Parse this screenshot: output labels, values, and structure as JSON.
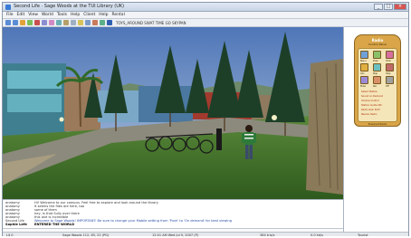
{
  "window": {
    "title": "Second Life · Sage Woods at the TUI Library (UK)"
  },
  "menubar": {
    "items": [
      "File",
      "Edit",
      "View",
      "World",
      "Tools",
      "Help",
      "Client",
      "Help",
      "Rental"
    ]
  },
  "toolbar": {
    "text": "TOYS_AROUND  SWAT  TIME  GO  SKYPAN"
  },
  "chat": {
    "lines": [
      {
        "who": "anatomy",
        "msg": "Hi! Welcome to our campus. Feel free to explore and look around the library"
      },
      {
        "who": "anatomy",
        "msg": "It seems the files are here, too"
      },
      {
        "who": "anatomy",
        "msg": "some of them"
      },
      {
        "who": "anatomy",
        "msg": "hey, is that Sully over there"
      },
      {
        "who": "anatomy",
        "msg": "this one is incredible"
      },
      {
        "who": "Second Life",
        "msg": "Welcome to Sage Woods! IMPORTANT: Be sure to change your Mobile setting from 'Push' to 'On demand' for best viewing"
      },
      {
        "who": "Sophie Lefe",
        "msg": "ENTERED THE WORLD"
      }
    ]
  },
  "status": {
    "money": "L$ 0",
    "coords": "Sage Woods 112, 83, 22 (PG)",
    "time": "12:01 AM Wed Jul 9, 2007 (P)",
    "fps": "384 tris/s",
    "traffic": "0.0 kb/s",
    "ping": "Tourist"
  },
  "hud": {
    "title": "Radio",
    "subtitle": "Control Panel",
    "buttons": [
      "Menu",
      "Pose",
      "Chat",
      "Info",
      "Map",
      "Help",
      "Mute",
      "Rec",
      "Off"
    ],
    "lines": [
      "Select Station",
      "Sound on Demand",
      "Volume Control",
      "Station Guide ON",
      "Radio Gain 8/15",
      "Rescan Radio"
    ],
    "footer": "Powered Radio",
    "accent": "#d9a548"
  }
}
